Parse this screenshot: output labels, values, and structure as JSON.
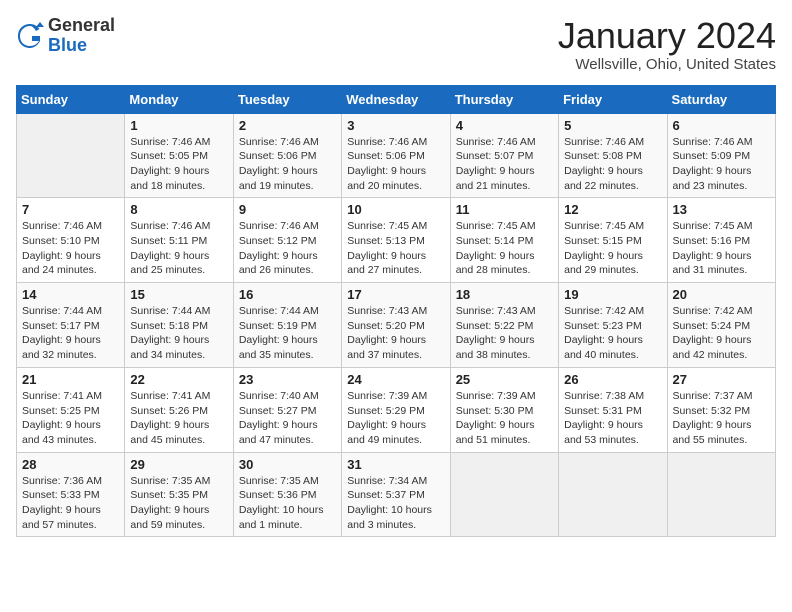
{
  "logo": {
    "general": "General",
    "blue": "Blue"
  },
  "header": {
    "month": "January 2024",
    "location": "Wellsville, Ohio, United States"
  },
  "days_of_week": [
    "Sunday",
    "Monday",
    "Tuesday",
    "Wednesday",
    "Thursday",
    "Friday",
    "Saturday"
  ],
  "weeks": [
    [
      {
        "day": "",
        "info": ""
      },
      {
        "day": "1",
        "info": "Sunrise: 7:46 AM\nSunset: 5:05 PM\nDaylight: 9 hours\nand 18 minutes."
      },
      {
        "day": "2",
        "info": "Sunrise: 7:46 AM\nSunset: 5:06 PM\nDaylight: 9 hours\nand 19 minutes."
      },
      {
        "day": "3",
        "info": "Sunrise: 7:46 AM\nSunset: 5:06 PM\nDaylight: 9 hours\nand 20 minutes."
      },
      {
        "day": "4",
        "info": "Sunrise: 7:46 AM\nSunset: 5:07 PM\nDaylight: 9 hours\nand 21 minutes."
      },
      {
        "day": "5",
        "info": "Sunrise: 7:46 AM\nSunset: 5:08 PM\nDaylight: 9 hours\nand 22 minutes."
      },
      {
        "day": "6",
        "info": "Sunrise: 7:46 AM\nSunset: 5:09 PM\nDaylight: 9 hours\nand 23 minutes."
      }
    ],
    [
      {
        "day": "7",
        "info": "Sunrise: 7:46 AM\nSunset: 5:10 PM\nDaylight: 9 hours\nand 24 minutes."
      },
      {
        "day": "8",
        "info": "Sunrise: 7:46 AM\nSunset: 5:11 PM\nDaylight: 9 hours\nand 25 minutes."
      },
      {
        "day": "9",
        "info": "Sunrise: 7:46 AM\nSunset: 5:12 PM\nDaylight: 9 hours\nand 26 minutes."
      },
      {
        "day": "10",
        "info": "Sunrise: 7:45 AM\nSunset: 5:13 PM\nDaylight: 9 hours\nand 27 minutes."
      },
      {
        "day": "11",
        "info": "Sunrise: 7:45 AM\nSunset: 5:14 PM\nDaylight: 9 hours\nand 28 minutes."
      },
      {
        "day": "12",
        "info": "Sunrise: 7:45 AM\nSunset: 5:15 PM\nDaylight: 9 hours\nand 29 minutes."
      },
      {
        "day": "13",
        "info": "Sunrise: 7:45 AM\nSunset: 5:16 PM\nDaylight: 9 hours\nand 31 minutes."
      }
    ],
    [
      {
        "day": "14",
        "info": "Sunrise: 7:44 AM\nSunset: 5:17 PM\nDaylight: 9 hours\nand 32 minutes."
      },
      {
        "day": "15",
        "info": "Sunrise: 7:44 AM\nSunset: 5:18 PM\nDaylight: 9 hours\nand 34 minutes."
      },
      {
        "day": "16",
        "info": "Sunrise: 7:44 AM\nSunset: 5:19 PM\nDaylight: 9 hours\nand 35 minutes."
      },
      {
        "day": "17",
        "info": "Sunrise: 7:43 AM\nSunset: 5:20 PM\nDaylight: 9 hours\nand 37 minutes."
      },
      {
        "day": "18",
        "info": "Sunrise: 7:43 AM\nSunset: 5:22 PM\nDaylight: 9 hours\nand 38 minutes."
      },
      {
        "day": "19",
        "info": "Sunrise: 7:42 AM\nSunset: 5:23 PM\nDaylight: 9 hours\nand 40 minutes."
      },
      {
        "day": "20",
        "info": "Sunrise: 7:42 AM\nSunset: 5:24 PM\nDaylight: 9 hours\nand 42 minutes."
      }
    ],
    [
      {
        "day": "21",
        "info": "Sunrise: 7:41 AM\nSunset: 5:25 PM\nDaylight: 9 hours\nand 43 minutes."
      },
      {
        "day": "22",
        "info": "Sunrise: 7:41 AM\nSunset: 5:26 PM\nDaylight: 9 hours\nand 45 minutes."
      },
      {
        "day": "23",
        "info": "Sunrise: 7:40 AM\nSunset: 5:27 PM\nDaylight: 9 hours\nand 47 minutes."
      },
      {
        "day": "24",
        "info": "Sunrise: 7:39 AM\nSunset: 5:29 PM\nDaylight: 9 hours\nand 49 minutes."
      },
      {
        "day": "25",
        "info": "Sunrise: 7:39 AM\nSunset: 5:30 PM\nDaylight: 9 hours\nand 51 minutes."
      },
      {
        "day": "26",
        "info": "Sunrise: 7:38 AM\nSunset: 5:31 PM\nDaylight: 9 hours\nand 53 minutes."
      },
      {
        "day": "27",
        "info": "Sunrise: 7:37 AM\nSunset: 5:32 PM\nDaylight: 9 hours\nand 55 minutes."
      }
    ],
    [
      {
        "day": "28",
        "info": "Sunrise: 7:36 AM\nSunset: 5:33 PM\nDaylight: 9 hours\nand 57 minutes."
      },
      {
        "day": "29",
        "info": "Sunrise: 7:35 AM\nSunset: 5:35 PM\nDaylight: 9 hours\nand 59 minutes."
      },
      {
        "day": "30",
        "info": "Sunrise: 7:35 AM\nSunset: 5:36 PM\nDaylight: 10 hours\nand 1 minute."
      },
      {
        "day": "31",
        "info": "Sunrise: 7:34 AM\nSunset: 5:37 PM\nDaylight: 10 hours\nand 3 minutes."
      },
      {
        "day": "",
        "info": ""
      },
      {
        "day": "",
        "info": ""
      },
      {
        "day": "",
        "info": ""
      }
    ]
  ]
}
